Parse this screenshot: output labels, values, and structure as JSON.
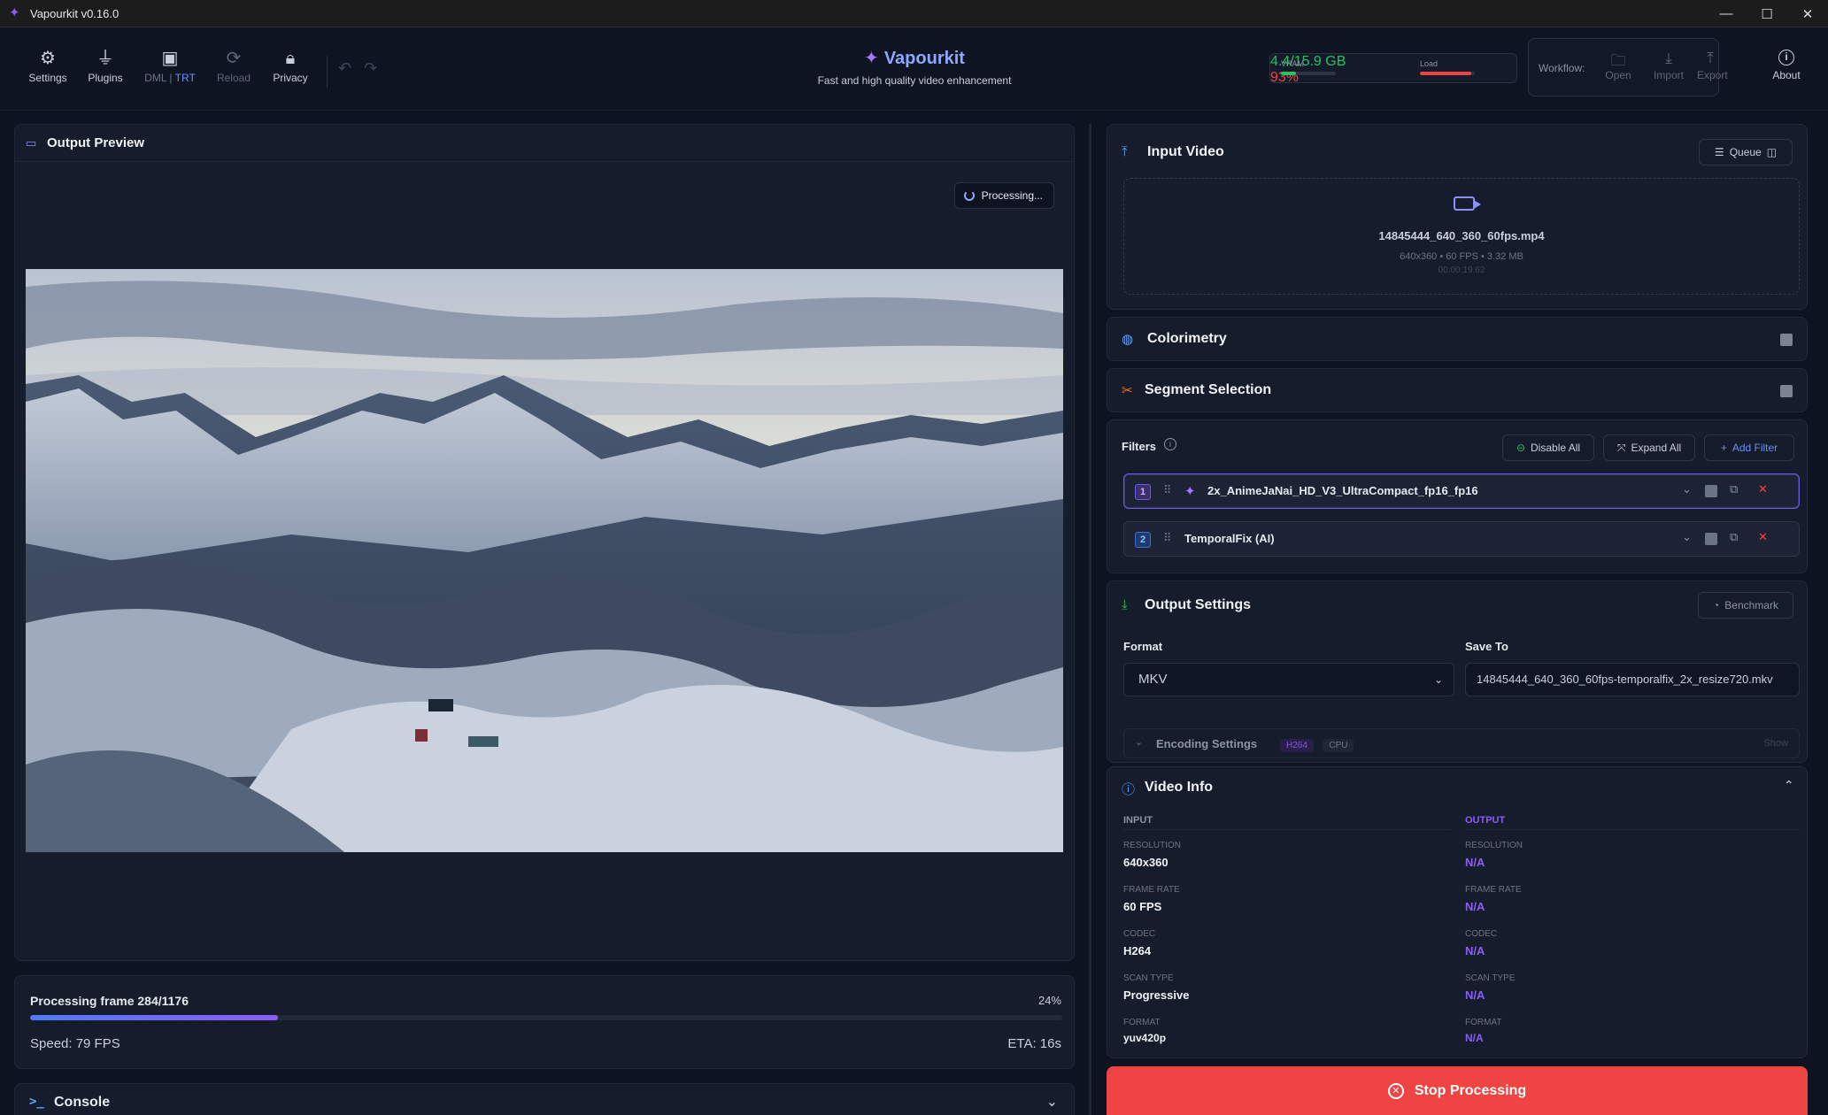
{
  "window": {
    "title": "Vapourkit v0.16.0"
  },
  "toolbar": {
    "settings": "Settings",
    "plugins": "Plugins",
    "backend_dml": "DML",
    "backend_sep": " | ",
    "backend_trt": "TRT",
    "reload": "Reload",
    "privacy": "Privacy"
  },
  "brand": {
    "name": "Vapourkit",
    "tagline": "Fast and high quality video enhancement"
  },
  "stats": {
    "vram_label": "VRAM",
    "vram_value": "4.4/15.9 GB",
    "vram_fraction": 0.28,
    "load_label": "Load",
    "load_value": "93%",
    "load_fraction": 0.93
  },
  "workflow": {
    "label": "Workflow:",
    "open": "Open",
    "import": "Import",
    "export": "Export"
  },
  "about": "About",
  "preview": {
    "title": "Output Preview",
    "status": "Processing..."
  },
  "progress": {
    "label": "Processing frame 284/1176",
    "percent": "24%",
    "fraction": 0.24,
    "speed": "Speed: 79 FPS",
    "eta": "ETA: 16s"
  },
  "console": {
    "title": "Console"
  },
  "input_video": {
    "title": "Input Video",
    "queue_button": "Queue",
    "file_name": "14845444_640_360_60fps.mp4",
    "meta": "640x360 • 60 FPS • 3.32 MB",
    "duration": "00:00:19.62"
  },
  "colorimetry": {
    "title": "Colorimetry"
  },
  "segment": {
    "title": "Segment Selection"
  },
  "filters": {
    "title": "Filters",
    "disable_all": "Disable All",
    "expand_all": "Expand All",
    "add_filter": "Add Filter",
    "items": [
      {
        "index": "1",
        "name": "2x_AnimeJaNai_HD_V3_UltraCompact_fp16_fp16"
      },
      {
        "index": "2",
        "name": "TemporalFix (AI)"
      }
    ]
  },
  "output_settings": {
    "title": "Output Settings",
    "benchmark": "Benchmark",
    "format_label": "Format",
    "format_value": "MKV",
    "save_label": "Save To",
    "save_value": "14845444_640_360_60fps-temporalfix_2x_resize720.mkv",
    "encoding_label": "Encoding Settings",
    "codec_chip": "H264",
    "device_chip": "CPU",
    "show": "Show"
  },
  "video_info": {
    "title": "Video Info",
    "input_head": "INPUT",
    "output_head": "OUTPUT",
    "rows": [
      {
        "key": "RESOLUTION",
        "input": "640x360",
        "output": "N/A"
      },
      {
        "key": "FRAME RATE",
        "input": "60 FPS",
        "output": "N/A"
      },
      {
        "key": "CODEC",
        "input": "H264",
        "output": "N/A"
      },
      {
        "key": "SCAN TYPE",
        "input": "Progressive",
        "output": "N/A"
      },
      {
        "key": "FORMAT",
        "input": "yuv420p",
        "output": "N/A"
      }
    ]
  },
  "stop_button": "Stop Processing",
  "colors": {
    "accent": "#8b5cf6",
    "brand_blue": "#8ea7ff",
    "stop_red": "#ef4444",
    "vram_green": "#22c55e",
    "load_red": "#ef4444"
  }
}
